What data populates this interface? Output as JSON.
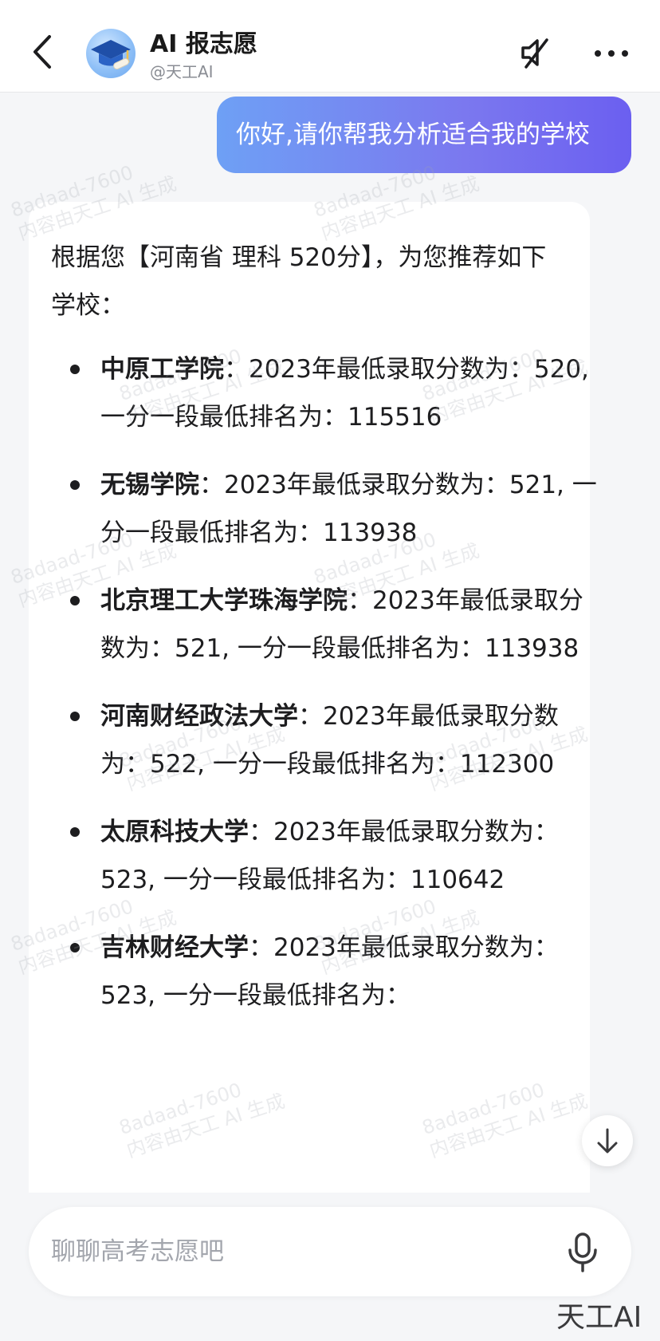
{
  "header": {
    "title": "AI 报志愿",
    "handle": "@天工AI",
    "icons": [
      "back-arrow-icon",
      "graduation-cap-icon",
      "muted-speaker-icon",
      "more-dots-icon"
    ]
  },
  "user_message": "你好,请你帮我分析适合我的学校",
  "bot_message": {
    "intro": "根据您【河南省 理科 520分】，为您推荐如下学校：",
    "schools": [
      {
        "name": "中原工学院",
        "sep": "：",
        "detail": "2023年最低录取分数为：520, 一分一段最低排名为：115516"
      },
      {
        "name": "无锡学院",
        "sep": "：",
        "detail": "2023年最低录取分数为：521, 一分一段最低排名为：113938"
      },
      {
        "name": "北京理工大学珠海学院",
        "sep": "：",
        "detail": "2023年最低录取分数为：521, 一分一段最低排名为：113938"
      },
      {
        "name": "河南财经政法大学",
        "sep": "：",
        "detail": "2023年最低录取分数为：522, 一分一段最低排名为：112300"
      },
      {
        "name": "太原科技大学",
        "sep": "：",
        "detail": "2023年最低录取分数为：523, 一分一段最低排名为：110642"
      },
      {
        "name": "吉林财经大学",
        "sep": "：",
        "detail": "2023年最低录取分数为：523, 一分一段最低排名为："
      }
    ]
  },
  "watermark": {
    "line1": "8adaad-7600",
    "line2": "内容由天工 AI 生成"
  },
  "input": {
    "placeholder": "聊聊高考志愿吧",
    "value": ""
  },
  "brand": "天工AI",
  "colors": {
    "user_bubble_start": "#6ea0f5",
    "user_bubble_end": "#6b5ff0",
    "page_bg": "#f5f6f8",
    "card_bg": "#ffffff"
  }
}
